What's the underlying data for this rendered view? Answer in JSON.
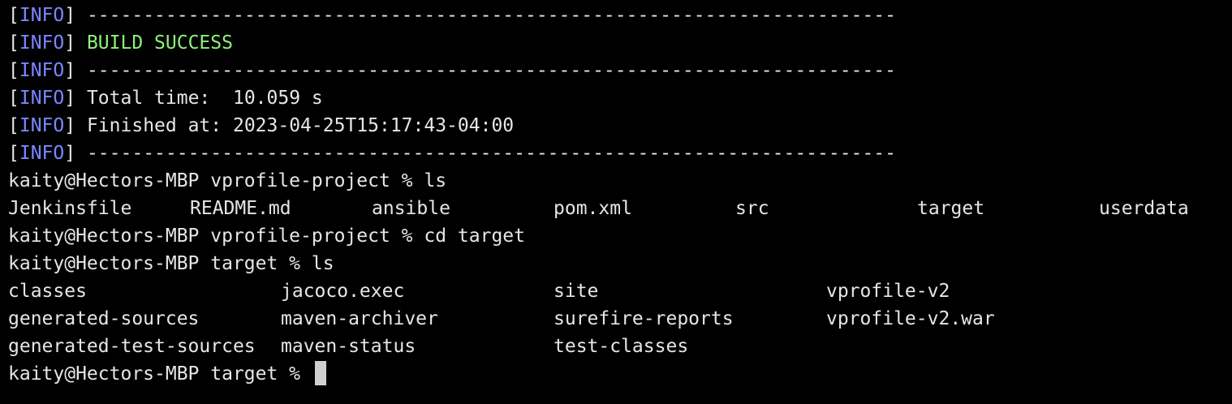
{
  "terminal": {
    "info_tag": "INFO",
    "separator": "------------------------------------------------------------------------",
    "build_result": "BUILD SUCCESS",
    "total_time": "Total time:  10.059 s",
    "finished_at": "Finished at: 2023-04-25T15:17:43-04:00",
    "prompt_project": "kaity@Hectors-MBP vprofile-project %",
    "prompt_target": "kaity@Hectors-MBP target %",
    "cmd_ls": "ls",
    "cmd_cd": "cd target",
    "ls_project": [
      "Jenkinsfile",
      "README.md",
      "ansible",
      "pom.xml",
      "src",
      "target",
      "userdata"
    ],
    "ls_target": [
      [
        "classes",
        "jacoco.exec",
        "site",
        "vprofile-v2"
      ],
      [
        "generated-sources",
        "maven-archiver",
        "surefire-reports",
        "vprofile-v2.war"
      ],
      [
        "generated-test-sources",
        "maven-status",
        "test-classes",
        ""
      ]
    ]
  },
  "colors": {
    "background": "#000000",
    "info": "#7b86ff",
    "success": "#8ff27c",
    "text": "#e6e6e6"
  }
}
